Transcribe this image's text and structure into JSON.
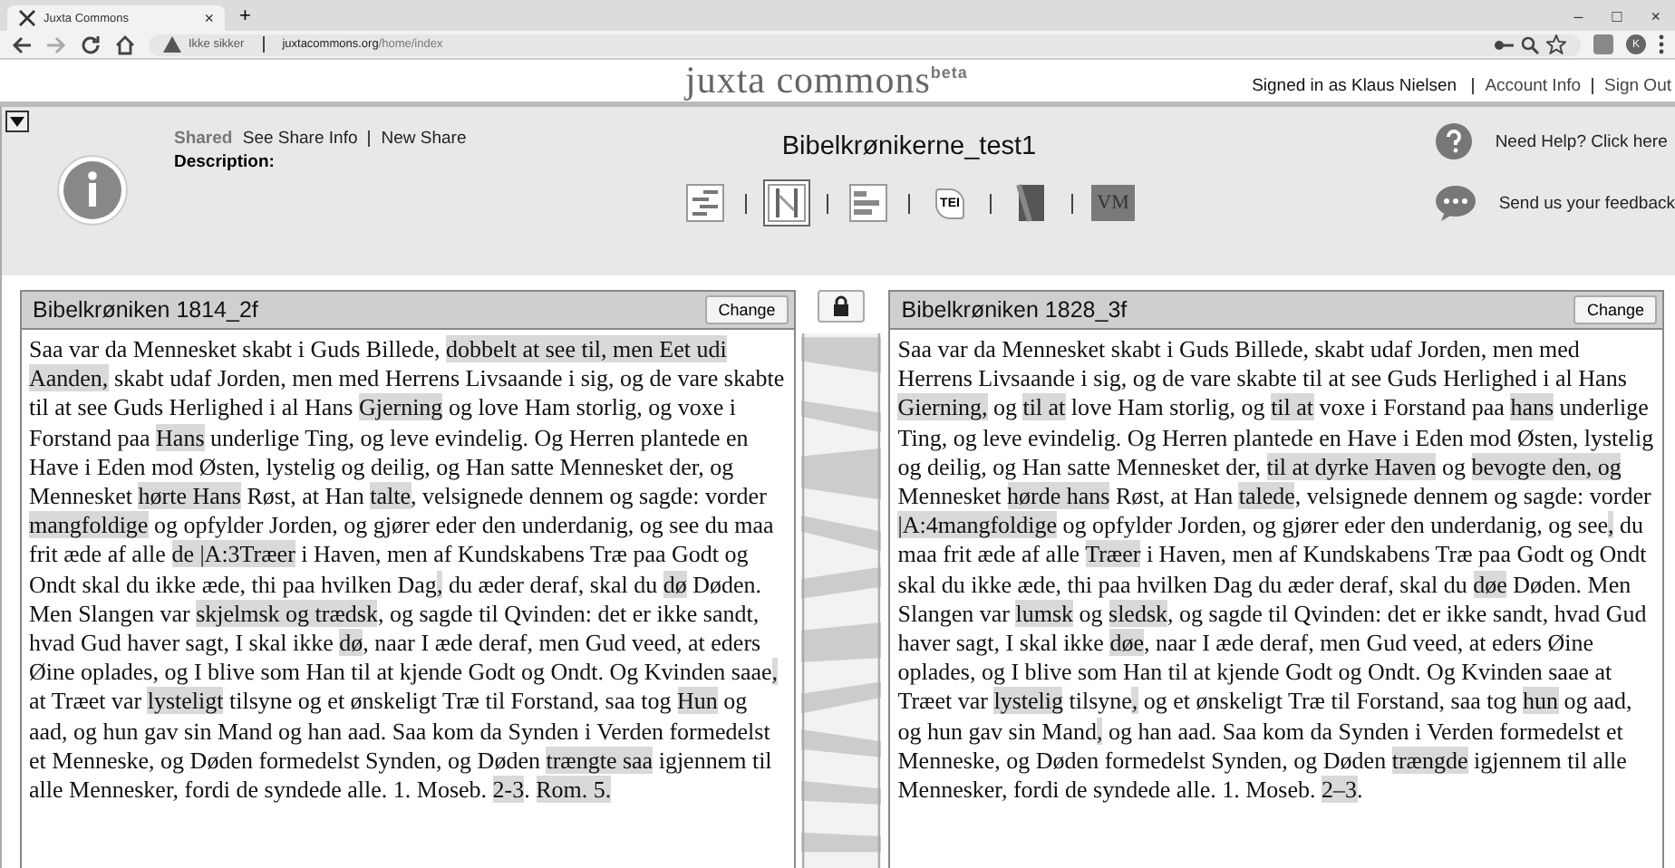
{
  "browser": {
    "tab": {
      "title": "Juxta Commons",
      "close": "×"
    },
    "new_tab": "+",
    "window_controls": [
      "–",
      "□",
      "×"
    ],
    "security": "Ikke sikker",
    "url": {
      "host": "juxtacommons.org",
      "path": "/home/index"
    },
    "profile": "K"
  },
  "header": {
    "logo": "juxta commons",
    "logo_sup": "beta",
    "signed_in": "Signed in as Klaus Nielsen",
    "links": [
      "Account Info",
      "Sign Out"
    ]
  },
  "toolbar": {
    "shared": "Shared",
    "share_links": [
      "See Share Info",
      "New Share"
    ],
    "description": "Description:",
    "title": "Bibelkrønikerne_test1",
    "views": [
      {
        "kind": "heatmap",
        "selected": false
      },
      {
        "kind": "side-by-side",
        "selected": true
      },
      {
        "kind": "histogram",
        "selected": false
      },
      {
        "kind": "label",
        "label": "TEI",
        "selected": false
      },
      {
        "kind": "book",
        "selected": false
      },
      {
        "kind": "badge",
        "label": "VM",
        "selected": false
      }
    ],
    "help": "Need Help? Click here",
    "feedback": "Send us your feedback"
  },
  "witnesses": [
    {
      "title": "Bibelkrøniken 1814_2f",
      "button": "Change",
      "segments": [
        {
          "text": "Saa var da Mennesket skabt i Guds Billede, ",
          "diff": false
        },
        {
          "text": "dobbelt at see til, men Eet udi Aanden,",
          "diff": true
        },
        {
          "text": " skabt udaf Jorden, men med Herrens Livsaande i sig, og de vare skabte til at see Guds Herlighed i al Hans ",
          "diff": false
        },
        {
          "text": "Gjerning",
          "diff": true
        },
        {
          "text": " og love Ham storlig, og voxe i Forstand paa ",
          "diff": false
        },
        {
          "text": "Hans",
          "diff": true
        },
        {
          "text": " underlige Ting, og leve evindelig. Og Herren plantede en Have i Eden mod Østen, lystelig og deilig, og Han satte Mennesket der, og Mennesket ",
          "diff": false
        },
        {
          "text": "hørte Hans",
          "diff": true
        },
        {
          "text": " Røst, at Han ",
          "diff": false
        },
        {
          "text": "talte",
          "diff": true
        },
        {
          "text": ", velsignede dennem og sagde: vorder ",
          "diff": false
        },
        {
          "text": "mangfoldige",
          "diff": true
        },
        {
          "text": " og opfylder Jorden, og gjører eder den underdanig, og see du maa frit æde af alle ",
          "diff": false
        },
        {
          "text": "de |A:3Træer",
          "diff": true
        },
        {
          "text": " i Haven, men af Kundskabens Træ paa Godt og Ondt skal du ikke æde, thi paa hvilken Dag",
          "diff": false
        },
        {
          "text": ",",
          "diff": true
        },
        {
          "text": " du æder deraf, skal du ",
          "diff": false
        },
        {
          "text": "dø",
          "diff": true
        },
        {
          "text": " Døden. Men Slangen var ",
          "diff": false
        },
        {
          "text": "skjelmsk og trædsk",
          "diff": true
        },
        {
          "text": ", og sagde til Qvinden: det er ikke sandt, hvad Gud haver sagt, I skal ikke ",
          "diff": false
        },
        {
          "text": "dø",
          "diff": true
        },
        {
          "text": ", naar I æde deraf, men Gud veed, at eders Øine oplades, og I blive som Han til at kjende Godt og Ondt. Og Kvinden saae",
          "diff": false
        },
        {
          "text": ",",
          "diff": true
        },
        {
          "text": " at Træet var ",
          "diff": false
        },
        {
          "text": "lysteligt",
          "diff": true
        },
        {
          "text": " tilsyne og et ønskeligt Træ til Forstand, saa tog ",
          "diff": false
        },
        {
          "text": "Hun",
          "diff": true
        },
        {
          "text": " og aad, og hun gav sin Mand og han aad. Saa kom da Synden i Verden formedelst et Menneske, og Døden formedelst Synden, og Døden ",
          "diff": false
        },
        {
          "text": "trængte saa",
          "diff": true
        },
        {
          "text": " igjennem til alle Mennesker, fordi de syndede alle. 1. Moseb. ",
          "diff": false
        },
        {
          "text": "2-3",
          "diff": true
        },
        {
          "text": ". ",
          "diff": false
        },
        {
          "text": "Rom. 5.",
          "diff": true
        }
      ]
    },
    {
      "title": "Bibelkrøniken 1828_3f",
      "button": "Change",
      "segments": [
        {
          "text": "Saa var da Mennesket skabt i Guds Billede, skabt udaf Jorden, men med Herrens Livsaande i sig, og de vare skabte til at see Guds Herlighed i al Hans ",
          "diff": false
        },
        {
          "text": "Gierning,",
          "diff": true
        },
        {
          "text": " og ",
          "diff": false
        },
        {
          "text": "til at",
          "diff": true
        },
        {
          "text": " love Ham storlig, og ",
          "diff": false
        },
        {
          "text": "til at",
          "diff": true
        },
        {
          "text": " voxe i Forstand paa ",
          "diff": false
        },
        {
          "text": "hans",
          "diff": true
        },
        {
          "text": " underlige Ting, og leve evindelig. Og Herren plantede en Have i Eden mod Østen, lystelig og deilig, og Han satte Mennesket der, ",
          "diff": false
        },
        {
          "text": "til at dyrke Haven",
          "diff": true
        },
        {
          "text": " og ",
          "diff": false
        },
        {
          "text": "bevogte den, og",
          "diff": true
        },
        {
          "text": " Mennesket ",
          "diff": false
        },
        {
          "text": "hørde hans",
          "diff": true
        },
        {
          "text": " Røst, at Han ",
          "diff": false
        },
        {
          "text": "talede",
          "diff": true
        },
        {
          "text": ", velsignede dennem og sagde: vorder ",
          "diff": false
        },
        {
          "text": "|A:4mangfoldige",
          "diff": true
        },
        {
          "text": " og opfylder Jorden, og gjører eder den underdanig, og see",
          "diff": false
        },
        {
          "text": ",",
          "diff": true
        },
        {
          "text": " du maa frit æde af alle ",
          "diff": false
        },
        {
          "text": "Træer",
          "diff": true
        },
        {
          "text": " i Haven, men af Kundskabens Træ paa Godt og Ondt skal du ikke æde, thi paa hvilken Dag du æder deraf, skal du ",
          "diff": false
        },
        {
          "text": "døe",
          "diff": true
        },
        {
          "text": " Døden. Men Slangen var ",
          "diff": false
        },
        {
          "text": "lumsk",
          "diff": true
        },
        {
          "text": " og ",
          "diff": false
        },
        {
          "text": "sledsk",
          "diff": true
        },
        {
          "text": ", og sagde til Qvinden: det er ikke sandt, hvad Gud haver sagt, I skal ikke ",
          "diff": false
        },
        {
          "text": "døe",
          "diff": true
        },
        {
          "text": ", naar I æde deraf, men Gud veed, at eders Øine oplades, og I blive som Han til at kjende Godt og Ondt. Og Kvinden saae at Træet var ",
          "diff": false
        },
        {
          "text": "lystelig",
          "diff": true
        },
        {
          "text": " tilsyne",
          "diff": false
        },
        {
          "text": ",",
          "diff": true
        },
        {
          "text": " og et ønskeligt Træ til Forstand, saa tog ",
          "diff": false
        },
        {
          "text": "hun",
          "diff": true
        },
        {
          "text": " og aad, og hun gav sin Mand",
          "diff": false
        },
        {
          "text": ",",
          "diff": true
        },
        {
          "text": " og han aad. Saa kom da Synden i Verden formedelst et Menneske, og Døden formedelst Synden, og Døden ",
          "diff": false
        },
        {
          "text": "trængde",
          "diff": true
        },
        {
          "text": " igjennem til alle Mennesker, fordi de syndede alle. 1. Moseb. ",
          "diff": false
        },
        {
          "text": "2–3",
          "diff": true
        },
        {
          "text": ".",
          "diff": false
        }
      ]
    }
  ]
}
